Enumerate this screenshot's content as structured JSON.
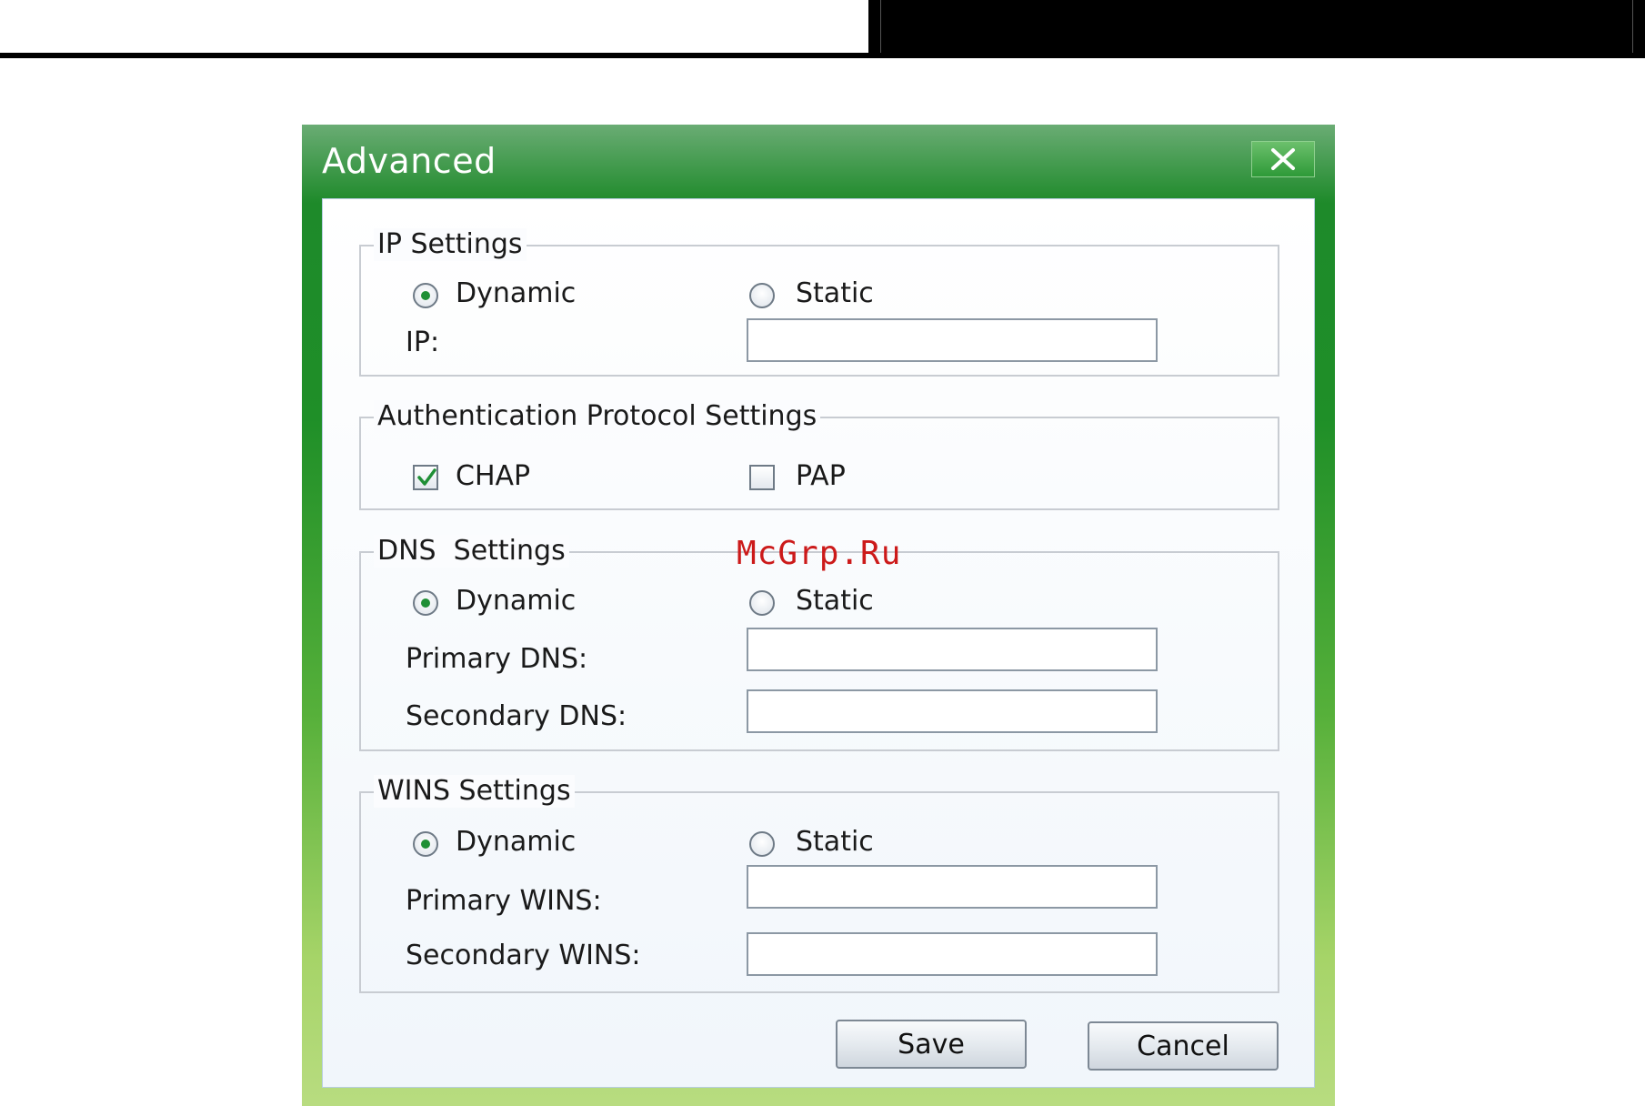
{
  "dialog": {
    "title": "Advanced",
    "close_icon": "close-x-icon"
  },
  "ip_settings": {
    "legend": "IP Settings",
    "dynamic_label": "Dynamic",
    "static_label": "Static",
    "selected": "Dynamic",
    "ip_label": "IP:",
    "ip_value": ""
  },
  "auth_settings": {
    "legend": "Authentication Protocol Settings",
    "chap_label": "CHAP",
    "chap_checked": true,
    "pap_label": "PAP",
    "pap_checked": false
  },
  "dns_settings": {
    "legend": "DNS  Settings",
    "dynamic_label": "Dynamic",
    "static_label": "Static",
    "selected": "Dynamic",
    "primary_label": "Primary DNS:",
    "primary_value": "",
    "secondary_label": "Secondary DNS:",
    "secondary_value": ""
  },
  "wins_settings": {
    "legend": "WINS Settings",
    "dynamic_label": "Dynamic",
    "static_label": "Static",
    "selected": "Dynamic",
    "primary_label": "Primary WINS:",
    "primary_value": "",
    "secondary_label": "Secondary WINS:",
    "secondary_value": ""
  },
  "buttons": {
    "save_label": "Save",
    "cancel_label": "Cancel"
  },
  "watermark": "McGrp.Ru",
  "colors": {
    "title_bar_green": "#1f8f28",
    "radio_dot": "#1f8f35",
    "watermark_red": "#cc1a1a"
  }
}
